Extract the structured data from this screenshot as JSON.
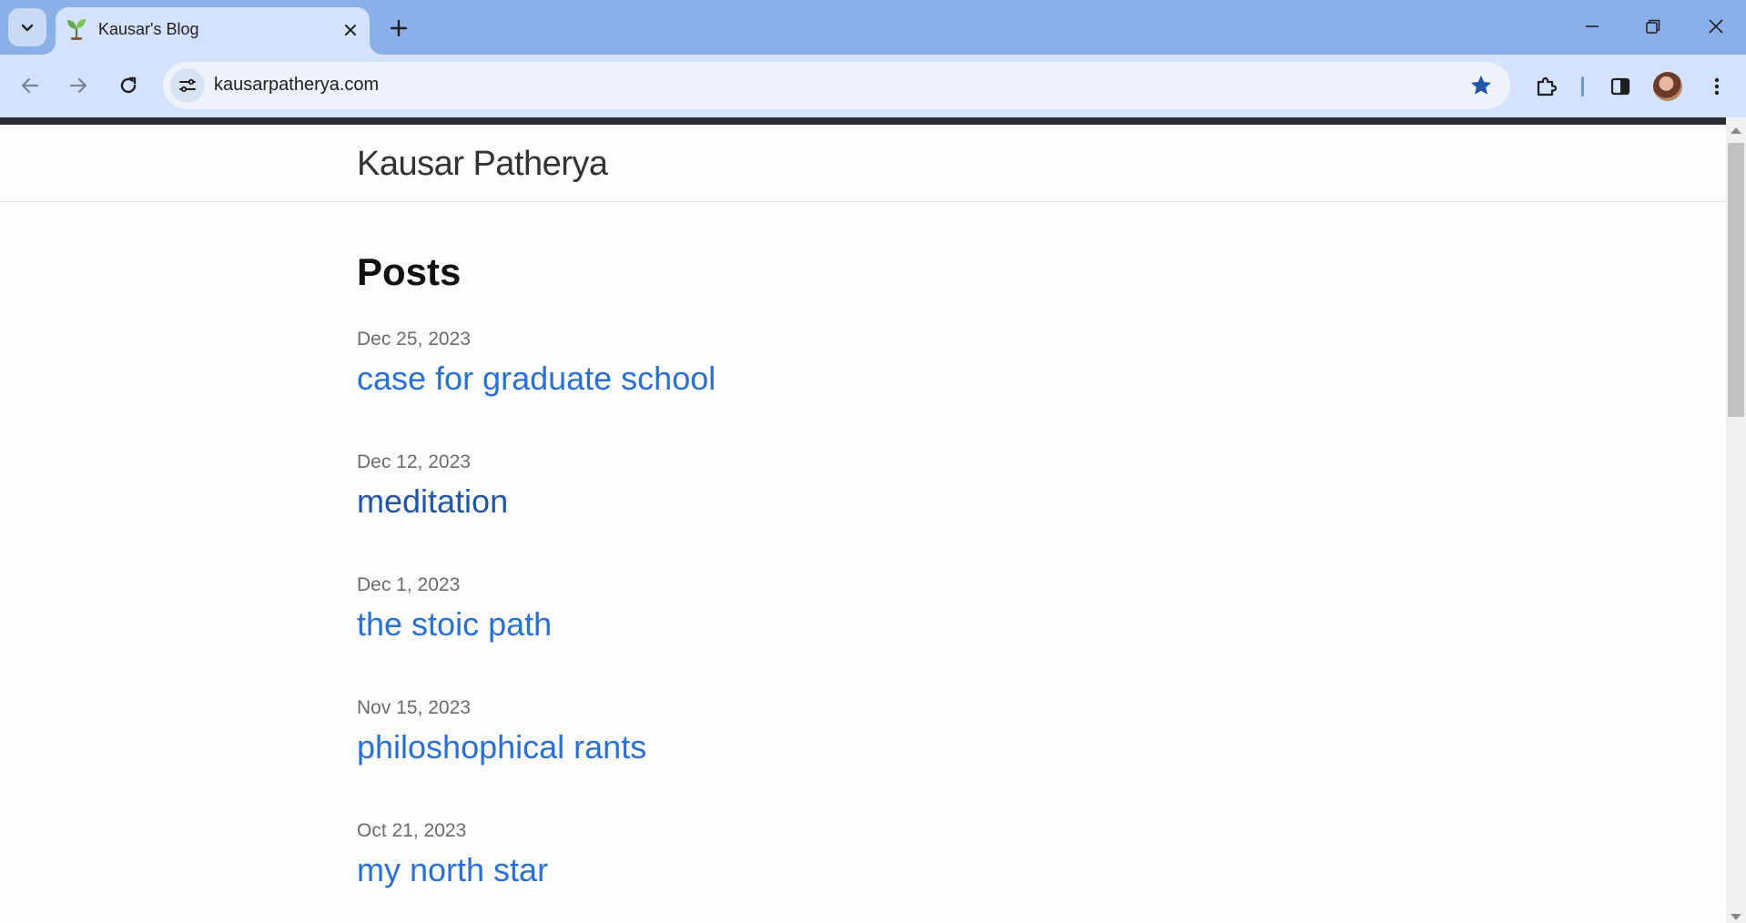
{
  "browser": {
    "tab": {
      "title": "Kausar's Blog",
      "favicon": "seedling-icon"
    },
    "url": "kausarpatherya.com",
    "bookmarked": true,
    "colors": {
      "frame": "#8aafe9",
      "toolbar": "#d3e3fd",
      "bookmark_star": "#1f56a8"
    }
  },
  "site": {
    "title": "Kausar Patherya"
  },
  "main": {
    "heading": "Posts",
    "posts": [
      {
        "date": "Dec 25, 2023",
        "title": "case for graduate school",
        "visited": false
      },
      {
        "date": "Dec 12, 2023",
        "title": "meditation",
        "visited": true
      },
      {
        "date": "Dec 1, 2023",
        "title": "the stoic path",
        "visited": false
      },
      {
        "date": "Nov 15, 2023",
        "title": "philoshophical rants",
        "visited": false
      },
      {
        "date": "Oct 21, 2023",
        "title": "my north star",
        "visited": false
      }
    ],
    "colors": {
      "link": "#2a6fd4",
      "link_visited": "#1f56a8",
      "date": "#6b6b6b"
    }
  }
}
